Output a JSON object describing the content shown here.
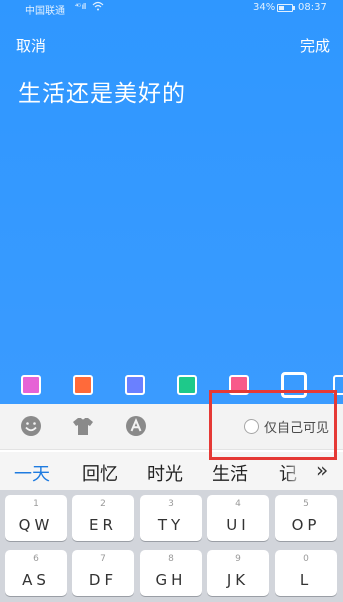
{
  "status_bar": {
    "carrier": "中国联通",
    "signal": "⁴ᴳ ıll",
    "battery": "34%",
    "time": "08:37"
  },
  "header": {
    "cancel_label": "取消",
    "done_label": "完成"
  },
  "editor": {
    "text": "生活还是美好的",
    "background_color": "#2f97ff"
  },
  "color_swatches": [
    {
      "name": "magenta",
      "color": "#e663d6"
    },
    {
      "name": "orange",
      "color": "#ff6a3a"
    },
    {
      "name": "periwinkle",
      "color": "#6a80ff"
    },
    {
      "name": "green",
      "color": "#1ec98a"
    },
    {
      "name": "pink",
      "color": "#f85a8a"
    },
    {
      "name": "blue",
      "color": "#2f97ff",
      "selected": true
    }
  ],
  "toolbar": {
    "icons": [
      "emoji-icon",
      "shirt-icon",
      "font-icon"
    ],
    "private_label": "仅自己可见"
  },
  "suggestions": [
    "一天",
    "回忆",
    "时光",
    "生活",
    "记"
  ],
  "keyboard": {
    "row1": [
      {
        "num": "1",
        "letters": "QW"
      },
      {
        "num": "2",
        "letters": "ER"
      },
      {
        "num": "3",
        "letters": "TY"
      },
      {
        "num": "4",
        "letters": "UI"
      },
      {
        "num": "5",
        "letters": "OP"
      }
    ],
    "row2": [
      {
        "num": "6",
        "letters": "AS"
      },
      {
        "num": "7",
        "letters": "DF"
      },
      {
        "num": "8",
        "letters": "GH"
      },
      {
        "num": "9",
        "letters": "JK"
      },
      {
        "num": "0",
        "letters": "L"
      }
    ]
  }
}
